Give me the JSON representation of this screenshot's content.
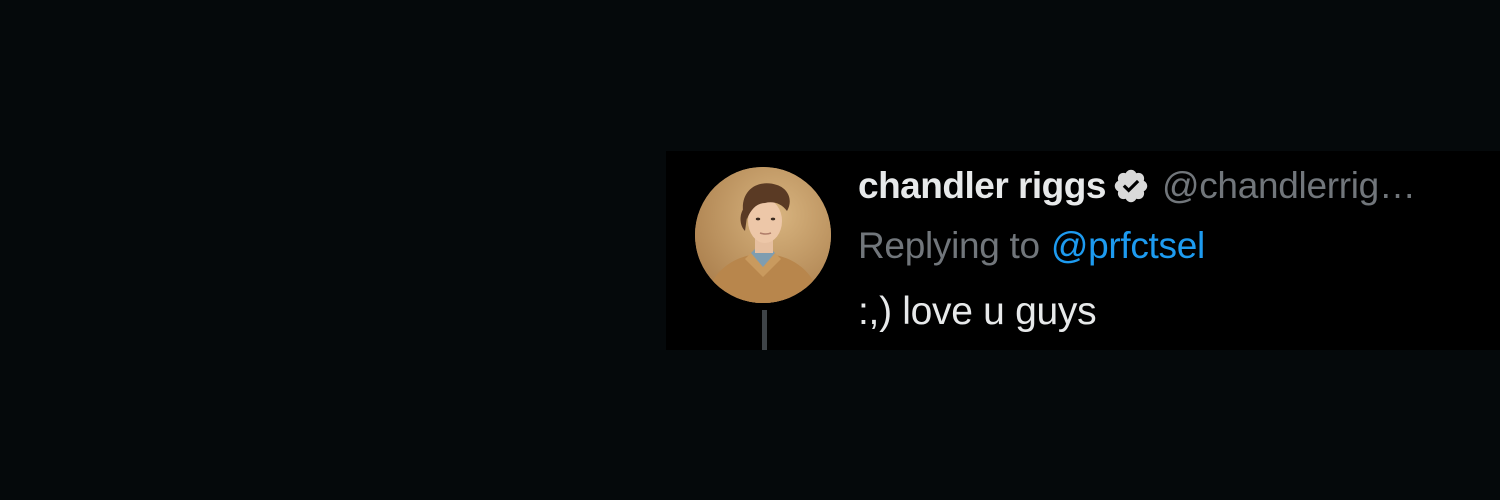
{
  "tweet": {
    "display_name": "chandler riggs",
    "handle": "@chandlerrig…",
    "verified": true,
    "replying_to_label": "Replying to",
    "replying_to_handle": "@prfctsel",
    "text": ":,) love u guys"
  },
  "icons": {
    "verified": "verified-badge-icon",
    "avatar": "profile-photo"
  },
  "colors": {
    "background": "#05090b",
    "card": "#000000",
    "name": "#e7e9ea",
    "secondary": "#71767b",
    "link": "#1d9bf0"
  }
}
